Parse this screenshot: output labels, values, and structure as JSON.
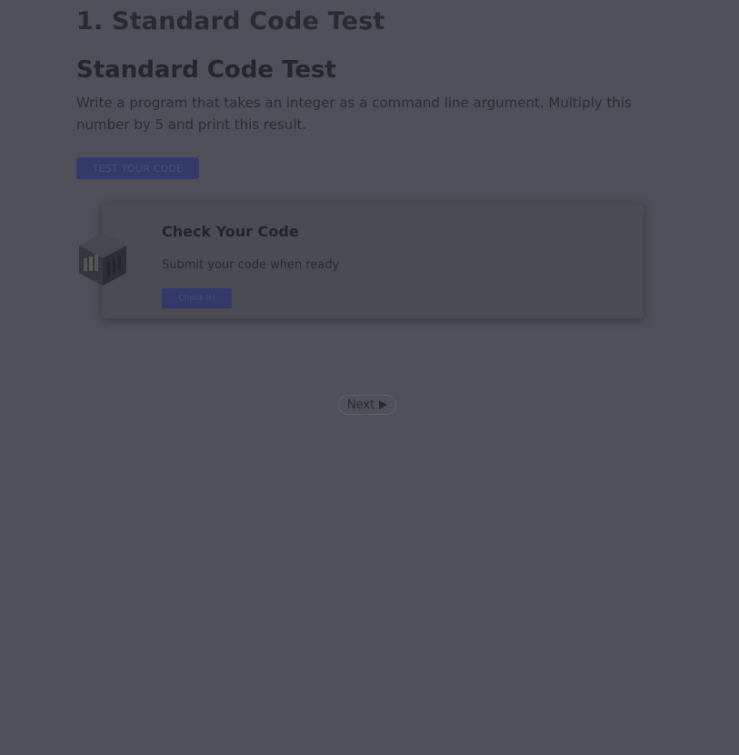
{
  "page": {
    "title": "1. Standard Code Test"
  },
  "exercise": {
    "heading": "Standard Code Test",
    "instructions": "Write a program that takes an integer as a command line argument. Multiply this number by 5 and print this result.",
    "test_button_label": "TEST YOUR CODE"
  },
  "check_card": {
    "badge_icon": "server-rack-icon",
    "title": "Check Your Code",
    "subtitle": "Submit your code when ready",
    "button_label": "Check It!"
  },
  "navigation": {
    "next_label": "Next",
    "next_icon": "play-icon"
  },
  "colors": {
    "overlay_background": "#4f5059",
    "primary_button": "#333a6a"
  }
}
